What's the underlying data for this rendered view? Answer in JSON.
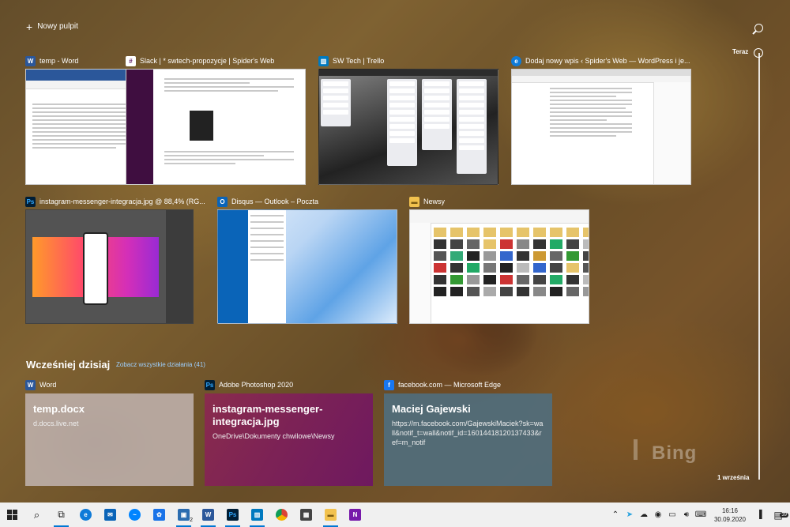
{
  "new_desktop": {
    "label": "Nowy pulpit"
  },
  "timeline": {
    "now_label": "Teraz",
    "date_label": "1 września"
  },
  "windows": [
    {
      "app": "Word",
      "title": "temp - Word",
      "icon": "word-icon"
    },
    {
      "app": "Slack",
      "title": "Slack | * swtech-propozycje | Spider's Web",
      "icon": "slack-icon"
    },
    {
      "app": "Trello",
      "title": "SW Tech | Trello",
      "icon": "trello-icon"
    },
    {
      "app": "Edge",
      "title": "Dodaj nowy wpis ‹ Spider's Web — WordPress i je...",
      "icon": "edge-icon"
    },
    {
      "app": "Photoshop",
      "title": "instagram-messenger-integracja.jpg @ 88,4% (RG...",
      "icon": "photoshop-icon"
    },
    {
      "app": "Outlook",
      "title": "Disqus — Outlook – Poczta",
      "icon": "outlook-icon"
    },
    {
      "app": "Explorer",
      "title": "Newsy",
      "icon": "folder-icon"
    }
  ],
  "earlier": {
    "title": "Wcześniej dzisiaj",
    "see_all": "Zobacz wszystkie działania (41)",
    "cards": [
      {
        "app": "Word",
        "title": "temp.docx",
        "sub": "d.docs.live.net",
        "color": "#b09e96"
      },
      {
        "app": "Adobe Photoshop 2020",
        "title": "instagram-messenger-integracja.jpg",
        "sub": "OneDrive\\Dokumenty chwilowe\\Newsy",
        "color": "#7a1a5a"
      },
      {
        "app": "facebook.com — Microsoft Edge",
        "title": "Maciej Gajewski",
        "sub": "https://m.facebook.com/GajewskiMaciek?sk=wall&notif_t=wall&notif_id=16014418120137433&ref=m_notif",
        "color": "#4a6a7a"
      }
    ]
  },
  "background_brand": "Bing",
  "taskbar": {
    "apps": [
      "windows-icon",
      "search-icon",
      "task-view-icon",
      "edge-icon",
      "mail-icon",
      "messenger-icon",
      "photos-icon",
      "files-icon",
      "word-icon",
      "photoshop-icon",
      "trello-icon",
      "chrome-icon",
      "calculator-icon",
      "explorer-icon",
      "onenote-icon"
    ],
    "files_badge": "2",
    "clock_time": "16:16",
    "clock_date": "30.09.2020",
    "notifications": "39"
  }
}
